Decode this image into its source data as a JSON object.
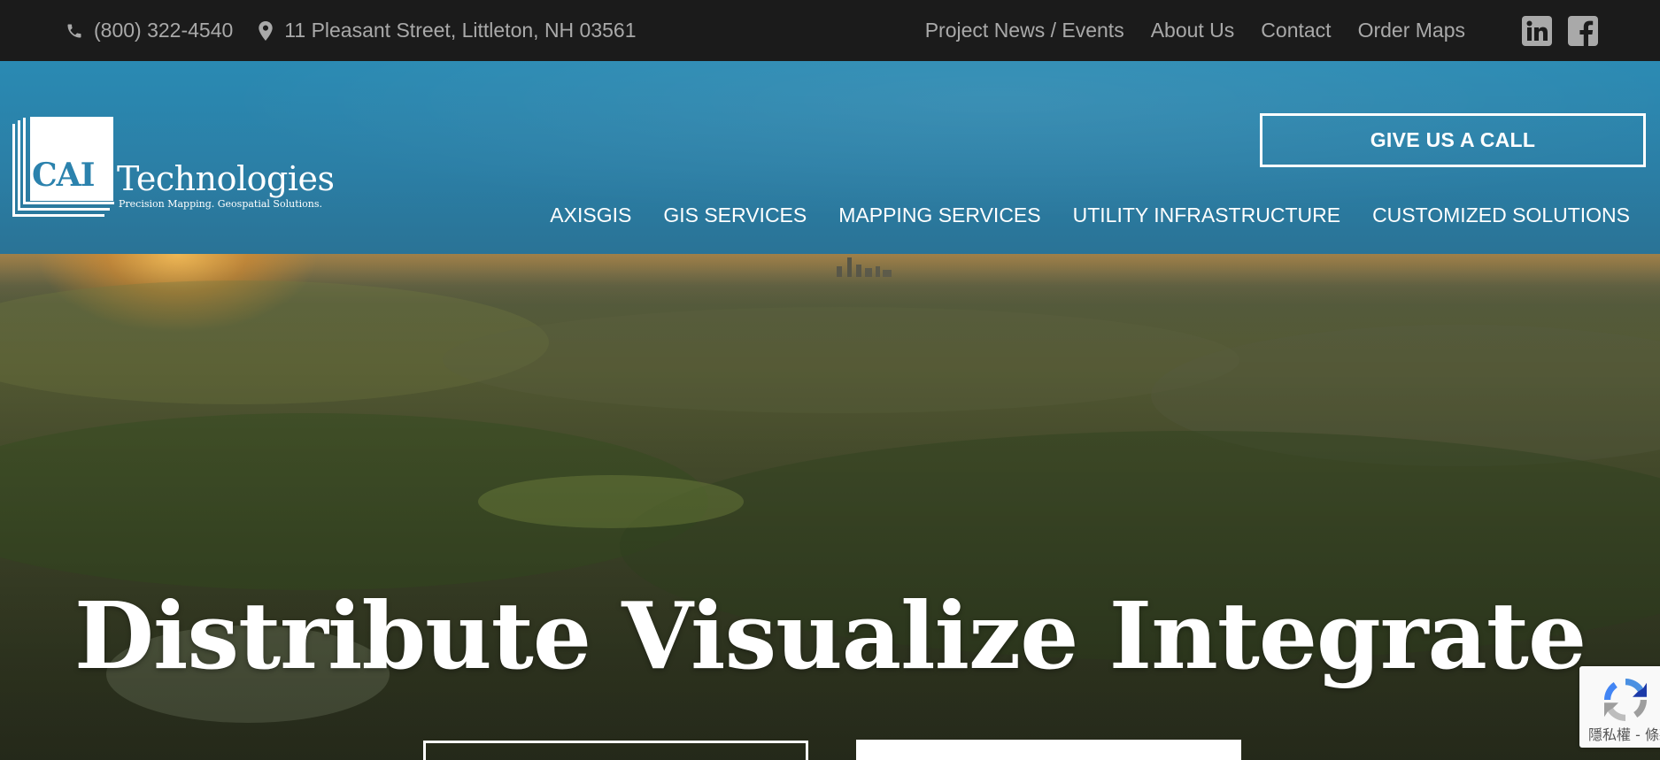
{
  "topbar": {
    "phone": "(800) 322-4540",
    "address": "11 Pleasant Street, Littleton, NH 03561",
    "utility_links": [
      {
        "label": "Project News / Events"
      },
      {
        "label": "About Us"
      },
      {
        "label": "Contact"
      },
      {
        "label": "Order Maps"
      }
    ],
    "social": [
      "linkedin-icon",
      "facebook-icon"
    ]
  },
  "header": {
    "logo": {
      "mark_text": "CAI",
      "wordmark": "Technologies",
      "tagline": "Precision Mapping. Geospatial Solutions."
    },
    "call_button_label": "GIVE US A CALL",
    "nav": [
      {
        "label": "AXISGIS"
      },
      {
        "label": "GIS SERVICES"
      },
      {
        "label": "MAPPING SERVICES"
      },
      {
        "label": "UTILITY INFRASTRUCTURE"
      },
      {
        "label": "CUSTOMIZED SOLUTIONS"
      }
    ]
  },
  "hero": {
    "title": "Distribute Visualize Integrate"
  },
  "recaptcha": {
    "text": "隱私權 - 條款"
  },
  "colors": {
    "topbar_bg": "#1b1b1b",
    "topbar_text": "#a9a9a9",
    "header_blue": "#2b82ad",
    "white": "#ffffff"
  }
}
